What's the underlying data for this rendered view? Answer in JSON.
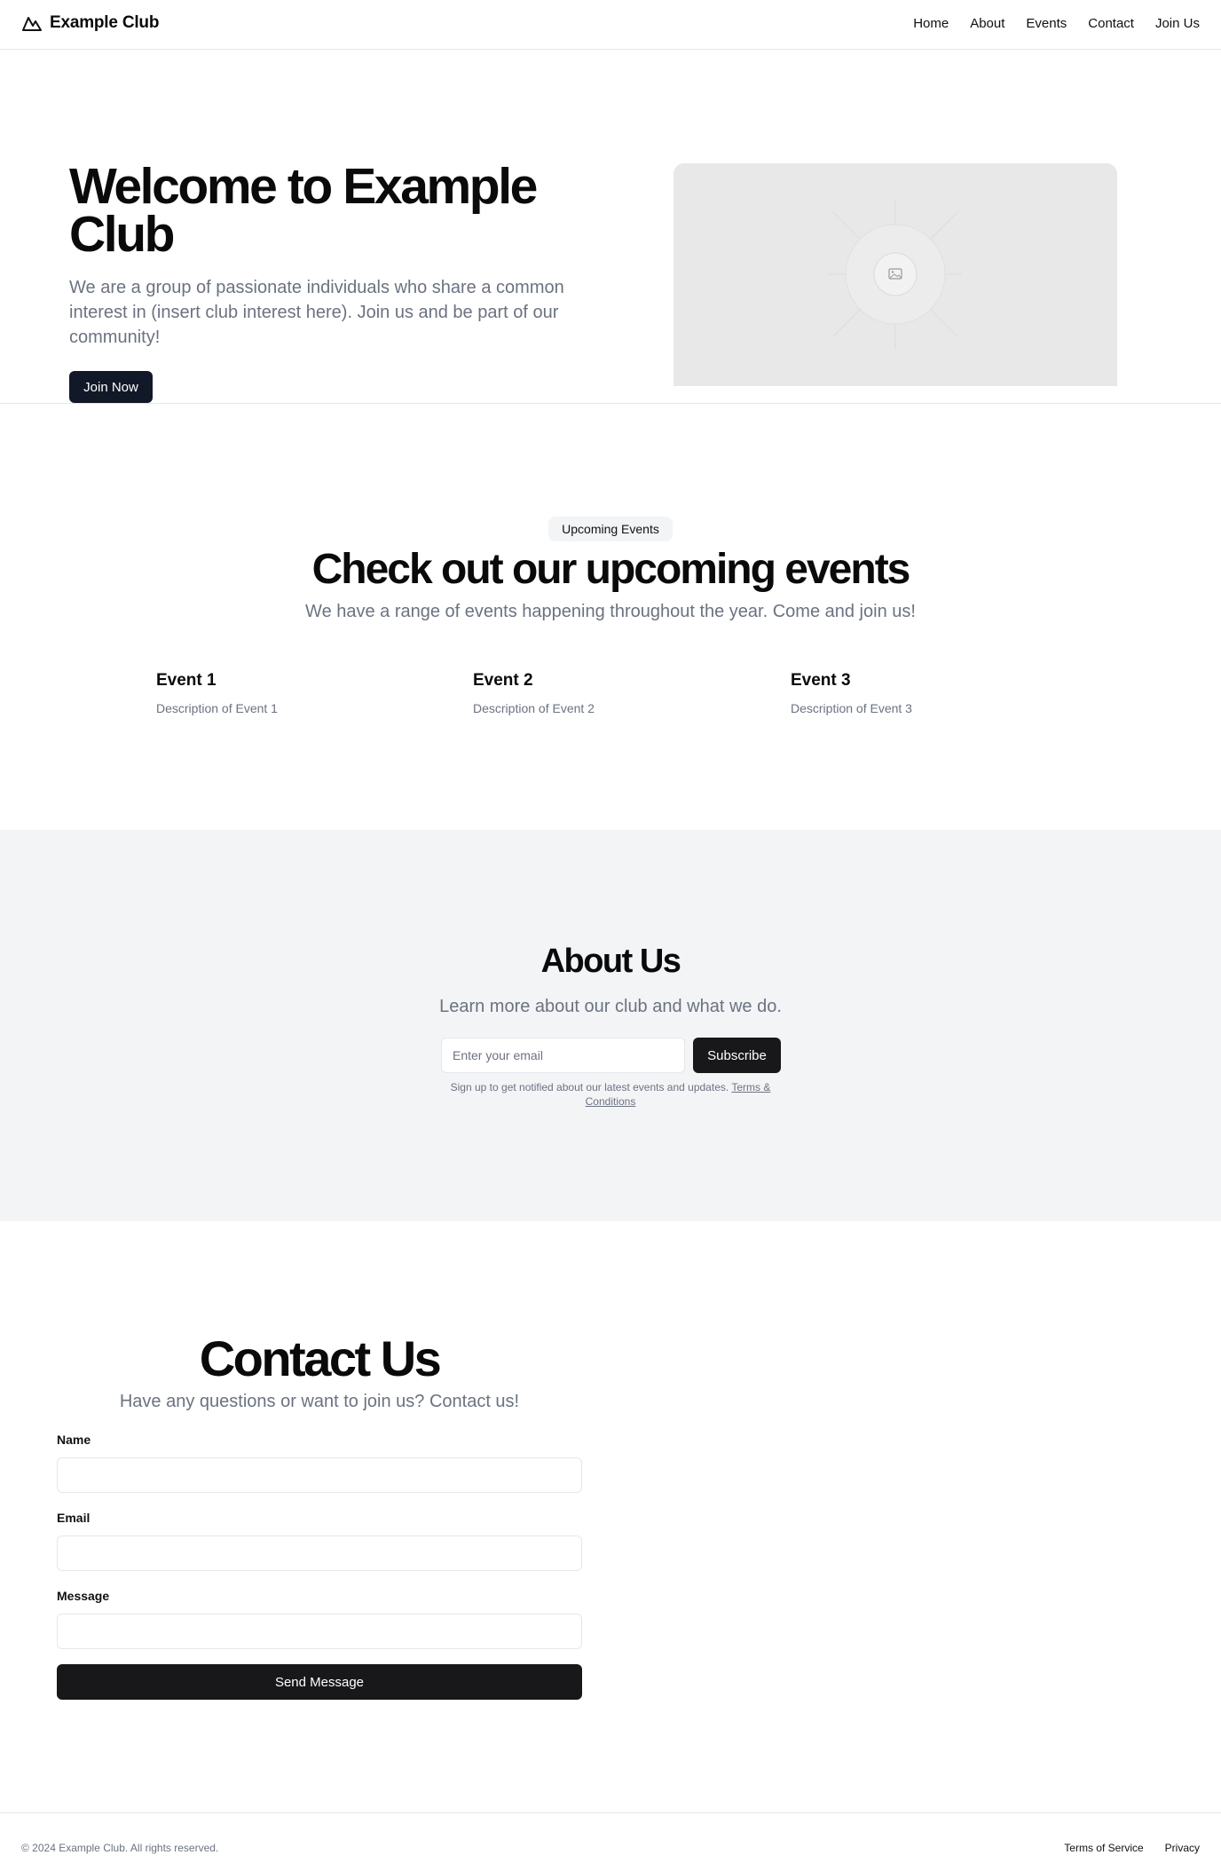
{
  "header": {
    "brand": "Example Club",
    "brand_icon": "mountain-icon",
    "nav": [
      "Home",
      "About",
      "Events",
      "Contact",
      "Join Us"
    ]
  },
  "hero": {
    "title": "Welcome to Example Club",
    "subtitle": "We are a group of passionate individuals who share a common interest in (insert club interest here). Join us and be part of our community!",
    "cta": "Join Now",
    "image_icon": "image-placeholder-icon"
  },
  "events": {
    "badge": "Upcoming Events",
    "title": "Check out our upcoming events",
    "subtitle": "We have a range of events happening throughout the year. Come and join us!",
    "items": [
      {
        "title": "Event 1",
        "desc": "Description of Event 1"
      },
      {
        "title": "Event 2",
        "desc": "Description of Event 2"
      },
      {
        "title": "Event 3",
        "desc": "Description of Event 3"
      }
    ]
  },
  "about": {
    "title": "About Us",
    "subtitle": "Learn more about our club and what we do.",
    "email_placeholder": "Enter your email",
    "subscribe": "Subscribe",
    "note": "Sign up to get notified about our latest events and updates.",
    "terms": "Terms & Conditions"
  },
  "contact": {
    "title": "Contact Us",
    "subtitle": "Have any questions or want to join us? Contact us!",
    "name_label": "Name",
    "email_label": "Email",
    "message_label": "Message",
    "send": "Send Message"
  },
  "footer": {
    "copyright": "© 2024 Example Club. All rights reserved.",
    "links": [
      "Terms of Service",
      "Privacy"
    ]
  },
  "colors": {
    "primary_button": "#111827",
    "muted_text": "#6b7280",
    "section_bg": "#f3f4f6"
  }
}
